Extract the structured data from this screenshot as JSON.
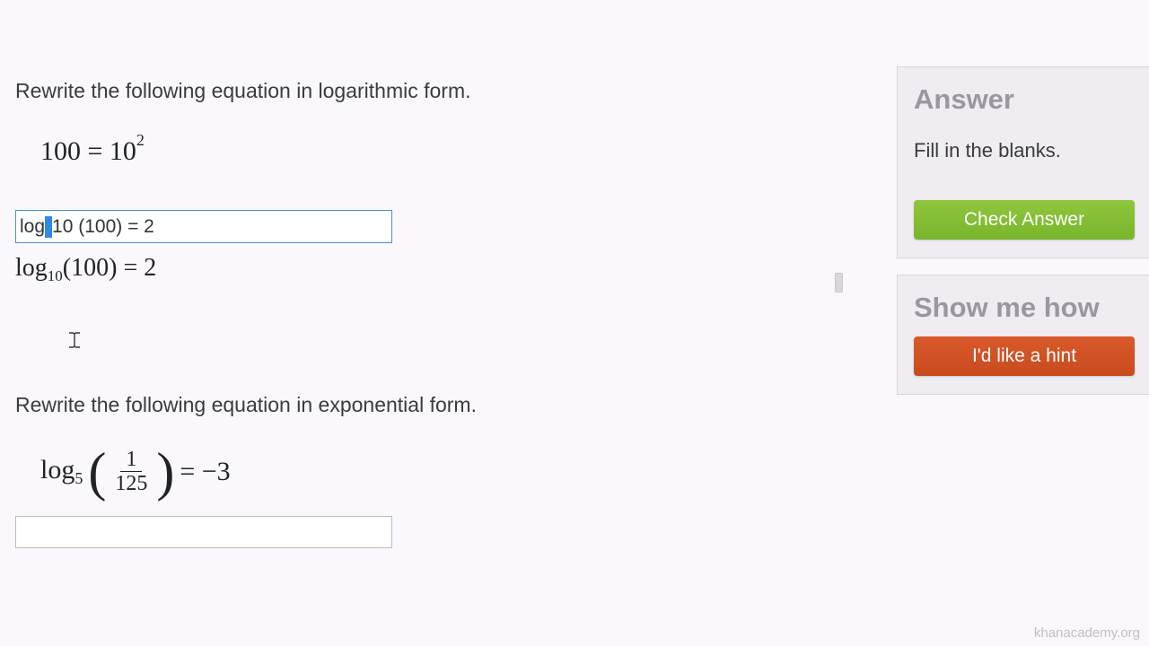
{
  "question1": {
    "prompt": "Rewrite the following equation in logarithmic form.",
    "equation_lhs": "100",
    "equation_base": "10",
    "equation_exp": "2",
    "input_pre": "log",
    "input_post": "10 (100) = 2",
    "preview_log": "log",
    "preview_base": "10",
    "preview_arg": "(100)",
    "preview_rhs": "= 2"
  },
  "question2": {
    "prompt": "Rewrite the following equation in exponential form.",
    "log_label": "log",
    "log_base": "5",
    "frac_num": "1",
    "frac_den": "125",
    "rhs": "= −3"
  },
  "sidebar": {
    "answer_title": "Answer",
    "answer_text": "Fill in the blanks.",
    "check_label": "Check Answer",
    "show_title": "Show me how",
    "hint_label": "I'd like a hint"
  },
  "watermark": "khanacademy.org"
}
